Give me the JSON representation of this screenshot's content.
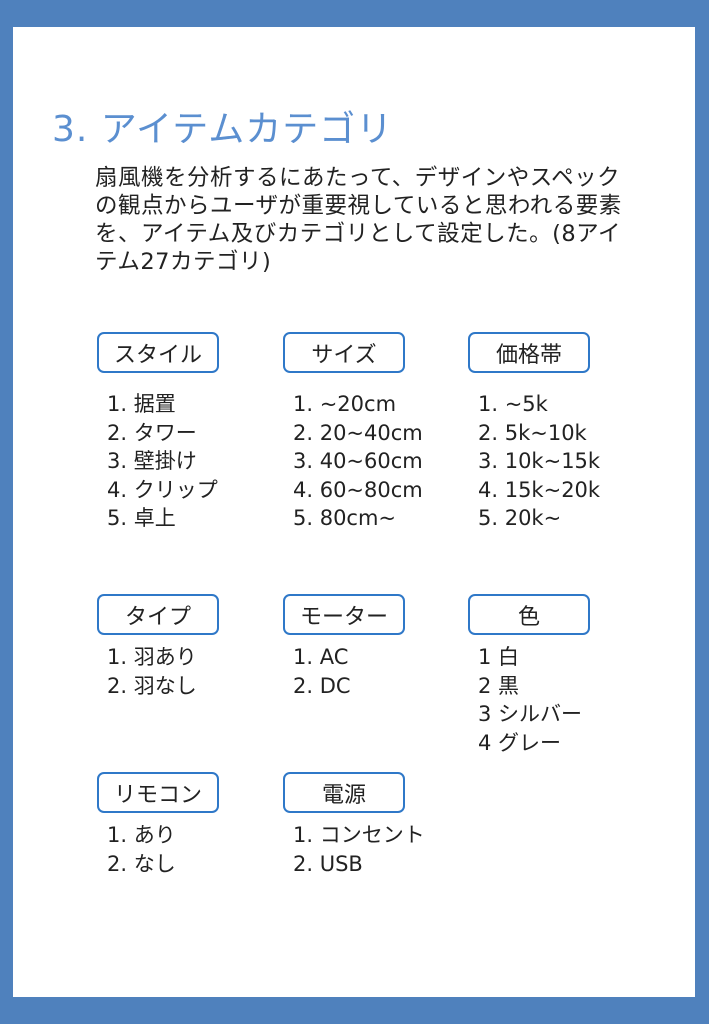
{
  "title": "3. アイテムカテゴリ",
  "description": "扇風機を分析するにあたって、デザインやスペックの観点からユーザが重要視していると思われる要素を、アイテム及びカテゴリとして設定した。(8アイテム27カテゴリ)",
  "categories": [
    {
      "label": "スタイル",
      "items": [
        "1. 据置",
        "2. タワー",
        "3. 壁掛け",
        "4. クリップ",
        "5. 卓上"
      ]
    },
    {
      "label": "サイズ",
      "items": [
        "1. ~20cm",
        "2. 20~40cm",
        "3. 40~60cm",
        "4. 60~80cm",
        "5. 80cm~"
      ]
    },
    {
      "label": "価格帯",
      "items": [
        "1. ~5k",
        "2. 5k~10k",
        "3. 10k~15k",
        "4. 15k~20k",
        "5. 20k~"
      ]
    },
    {
      "label": "タイプ",
      "items": [
        "1. 羽あり",
        "2. 羽なし"
      ]
    },
    {
      "label": "モーター",
      "items": [
        "1. AC",
        "2. DC"
      ]
    },
    {
      "label": "色",
      "items": [
        "1 白",
        "2 黒",
        "3 シルバー",
        "4 グレー"
      ]
    },
    {
      "label": "リモコン",
      "items": [
        "1. あり",
        "2. なし"
      ]
    },
    {
      "label": "電源",
      "items": [
        "1. コンセント",
        "2. USB"
      ]
    }
  ]
}
